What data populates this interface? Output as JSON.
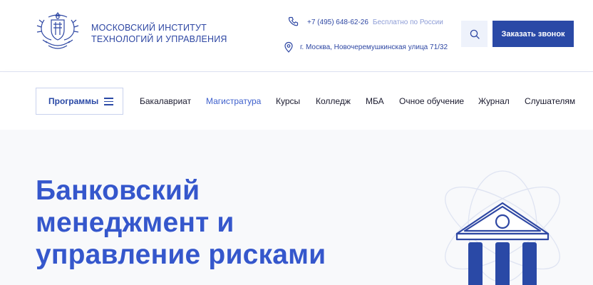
{
  "header": {
    "org_name_line1": "МОСКОВСКИЙ ИНСТИТУТ",
    "org_name_line2": "ТЕХНОЛОГИЙ И УПРАВЛЕНИЯ",
    "phone": "+7 (495) 648-62-26",
    "phone_note": "Бесплатно по России",
    "address": "г. Москва, Новочеремушкинская улица 71/32",
    "call_button": "Заказать звонок"
  },
  "nav": {
    "programs_label": "Программы",
    "items": [
      {
        "label": "Бакалавриат",
        "active": false
      },
      {
        "label": "Магистратура",
        "active": true
      },
      {
        "label": "Курсы",
        "active": false
      },
      {
        "label": "Колледж",
        "active": false
      },
      {
        "label": "МБА",
        "active": false
      },
      {
        "label": "Очное обучение",
        "active": false
      },
      {
        "label": "Журнал",
        "active": false
      },
      {
        "label": "Слушателям",
        "active": false
      }
    ]
  },
  "hero": {
    "title_line1": "Банковский",
    "title_line2": "менеджмент и",
    "title_line3": "управление рисками"
  },
  "colors": {
    "brand": "#2a49a6",
    "accent": "#3557cc",
    "muted": "#8c9cd6",
    "hero_bg": "#f8f9fb"
  },
  "icons": {
    "logo": "coat-of-arms-icon",
    "phone": "phone-icon",
    "location": "map-pin-icon",
    "search": "search-icon",
    "menu": "hamburger-icon",
    "hero": "bank-building-icon"
  }
}
